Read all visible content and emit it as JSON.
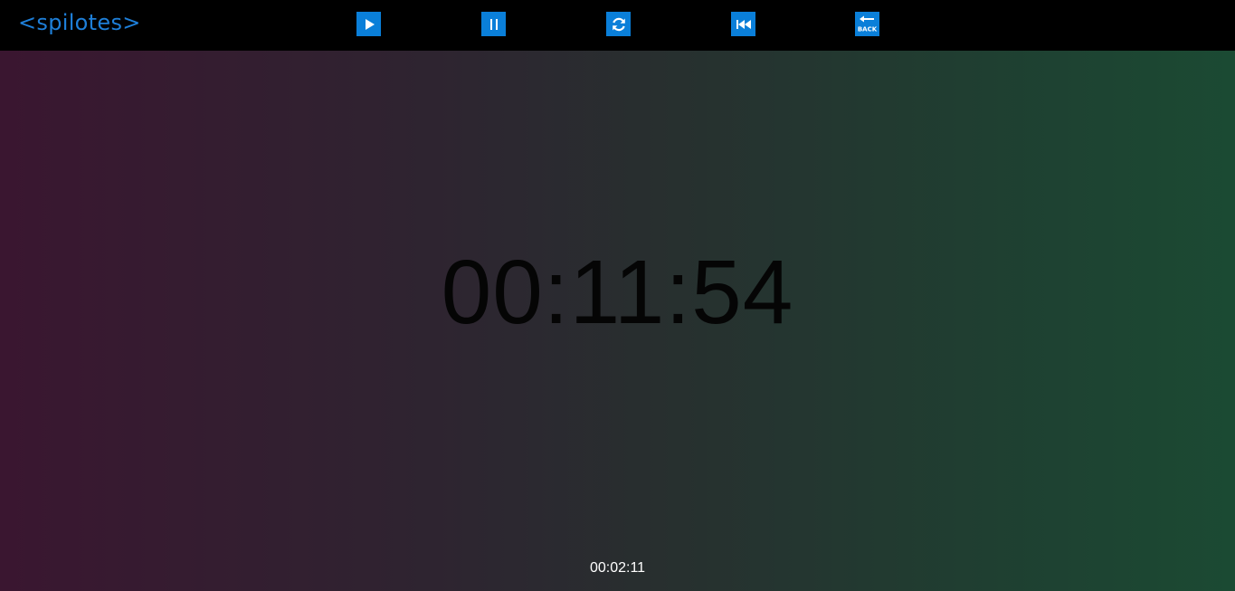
{
  "brand": {
    "text": "<spilotes>",
    "color": "#1e7fd8"
  },
  "controls": [
    {
      "name": "play",
      "icon": "play-icon"
    },
    {
      "name": "pause",
      "icon": "pause-icon"
    },
    {
      "name": "reload",
      "icon": "reload-icon"
    },
    {
      "name": "rewind",
      "icon": "rewind-icon"
    },
    {
      "name": "back",
      "icon": "back-icon",
      "label": "BACK"
    }
  ],
  "accent_color": "#0a7fd9",
  "timer": {
    "main": "00:11:54",
    "secondary": "00:02:11"
  }
}
